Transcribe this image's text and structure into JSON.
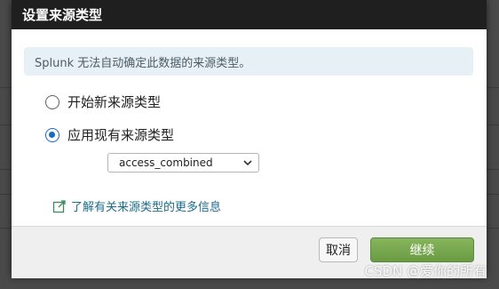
{
  "dialog": {
    "title": "设置来源类型",
    "info_message": "Splunk 无法自动确定此数据的来源类型。",
    "options": [
      {
        "label": "开始新来源类型",
        "checked": false
      },
      {
        "label": "应用现有来源类型",
        "checked": true
      }
    ],
    "sourcetype_select": {
      "selected": "access_combined"
    },
    "learn_more_link": "了解有关来源类型的更多信息",
    "cancel_label": "取消",
    "continue_label": "继续"
  },
  "colors": {
    "title_bar": "#1f1f1f",
    "info_bg": "#e7f0f4",
    "radio_checked": "#1a67c8",
    "link": "#1b6d8c",
    "primary_button": "#6a9a43"
  },
  "icons": {
    "learn_more": "external-link-icon",
    "select_arrow": "chevron-down-icon"
  },
  "watermark": "CSDN @爱你的所有"
}
